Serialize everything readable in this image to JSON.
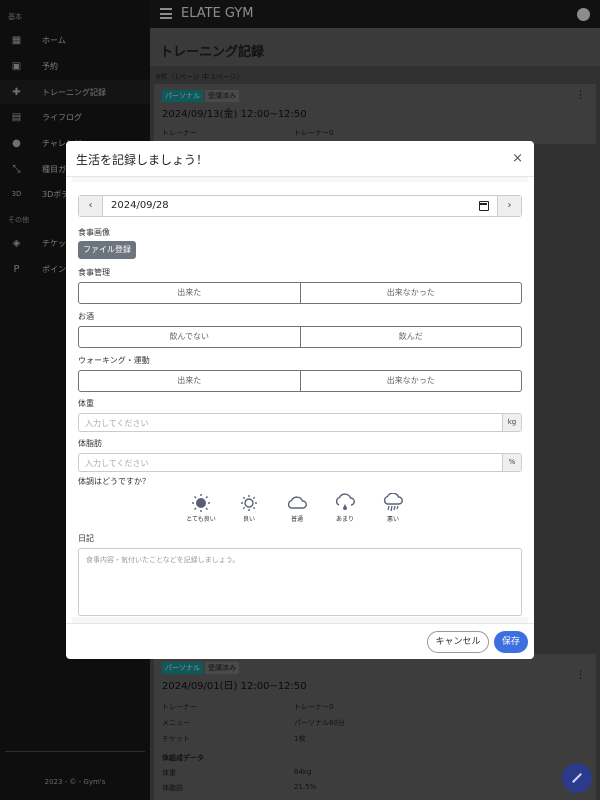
{
  "header": {
    "brand": "ELATE GYM"
  },
  "sidebar": {
    "section_basic": "基本",
    "section_other": "その他",
    "items": [
      {
        "label": "ホーム",
        "icon": "dashboard-icon"
      },
      {
        "label": "予約",
        "icon": "calendar-icon"
      },
      {
        "label": "トレーニング記録",
        "icon": "dumbbell-icon"
      },
      {
        "label": "ライフログ",
        "icon": "meal-icon"
      },
      {
        "label": "チャレンジ",
        "icon": "group-icon"
      },
      {
        "label": "種目ガイド",
        "icon": "arrows-icon"
      },
      {
        "label": "3Dボディ",
        "icon": "3d-icon"
      },
      {
        "label": "チケット",
        "icon": "tag-icon"
      },
      {
        "label": "ポイント",
        "icon": "point-icon"
      }
    ],
    "footer": "2023 - © - Gym's"
  },
  "main": {
    "title": "トレーニング記録",
    "count": "6件（1ページ 中 1ページ）",
    "card_top": {
      "tag1": "パーソナル",
      "tag2": "受講済み",
      "date": "2024/09/13(金) 12:00~12:50",
      "row_label": "トレーナー",
      "row_value": "トレーナー0"
    },
    "card_bottom": {
      "tag1": "パーソナル",
      "tag2": "受講済み",
      "date": "2024/09/01(日) 12:00~12:50",
      "rows": [
        {
          "label": "トレーナー",
          "value": "トレーナー0"
        },
        {
          "label": "メニュー",
          "value": "パーソナル60分"
        },
        {
          "label": "チケット",
          "value": "1枚"
        }
      ],
      "body_heading": "体組成データ",
      "body_rows": [
        {
          "label": "体重",
          "value": "64kg"
        },
        {
          "label": "体脂肪",
          "value": "21.5%"
        }
      ]
    }
  },
  "modal": {
    "title": "生活を記録しましょう！",
    "close": "×",
    "date": "2024/09/28",
    "prev": "‹",
    "next": "›",
    "meal_image_label": "食事画像",
    "file_button": "ファイル登録",
    "meal_label": "食事管理",
    "meal_options": [
      "出来た",
      "出来なかった"
    ],
    "alcohol_label": "お酒",
    "alcohol_options": [
      "飲んでない",
      "飲んだ"
    ],
    "walking_label": "ウォーキング・運動",
    "walking_options": [
      "出来た",
      "出来なかった"
    ],
    "weight_label": "体重",
    "weight_placeholder": "入力してください",
    "weight_unit": "kg",
    "fat_label": "体脂肪",
    "fat_placeholder": "入力してください",
    "fat_unit": "%",
    "condition_label": "体調はどうですか？",
    "moods": [
      {
        "label": "とても良い",
        "icon": "sun-filled-icon"
      },
      {
        "label": "良い",
        "icon": "sun-icon"
      },
      {
        "label": "普通",
        "icon": "cloud-icon"
      },
      {
        "label": "あまり",
        "icon": "cloud-drizzle-icon"
      },
      {
        "label": "悪い",
        "icon": "cloud-rain-icon"
      }
    ],
    "diary_label": "日記",
    "diary_placeholder": "食事内容・気付いたことなどを記録しましょう。",
    "cancel": "キャンセル",
    "save": "保存"
  }
}
